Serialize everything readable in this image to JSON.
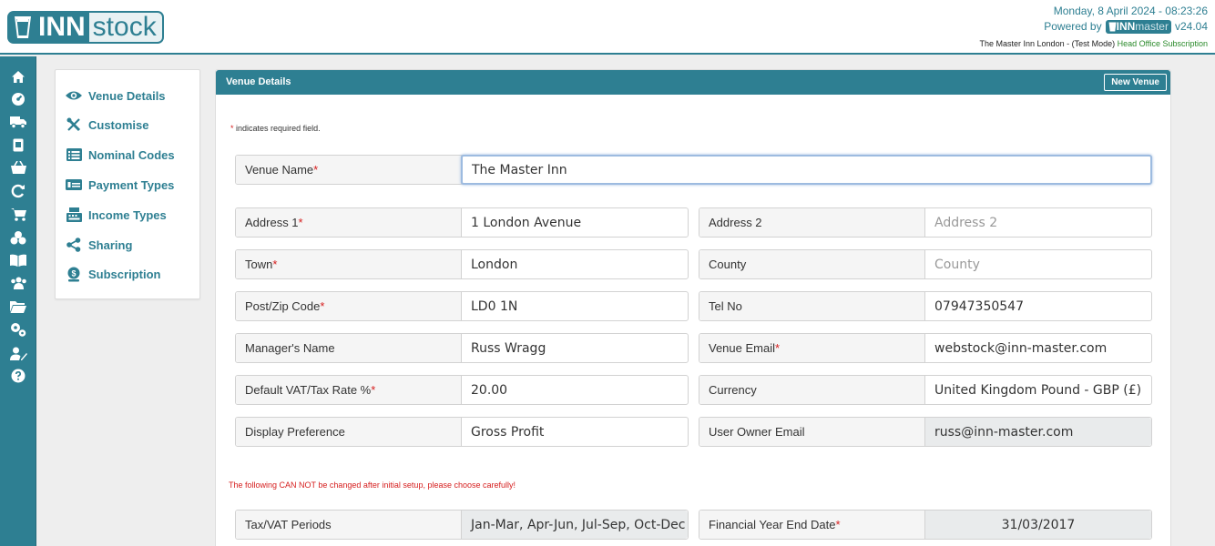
{
  "header": {
    "logo": {
      "part1": "INN",
      "part2": "stock"
    },
    "date_time": "Monday, 8 April 2024 - 08:23:26",
    "powered_by": "Powered by",
    "powered_logo": {
      "part1": "INN",
      "part2": "master"
    },
    "version": "v24.04",
    "venue_mode": "The Master Inn London - (Test Mode)",
    "subscription": "Head Office Subscription"
  },
  "rail": {
    "icons": [
      "home-icon",
      "dashboard-icon",
      "delivery-truck-icon",
      "stock-glass-icon",
      "basket-icon",
      "refresh-icon",
      "shopping-cart-icon",
      "products-icon",
      "book-icon",
      "users-icon",
      "folder-icon",
      "settings-icon",
      "user-edit-icon",
      "help-icon"
    ]
  },
  "subnav": {
    "items": [
      {
        "label": "Venue Details",
        "icon": "eye-icon"
      },
      {
        "label": "Customise",
        "icon": "tools-icon"
      },
      {
        "label": "Nominal Codes",
        "icon": "list-icon"
      },
      {
        "label": "Payment Types",
        "icon": "money-icon"
      },
      {
        "label": "Income Types",
        "icon": "cash-register-icon"
      },
      {
        "label": "Sharing",
        "icon": "share-icon"
      },
      {
        "label": "Subscription",
        "icon": "coin-icon"
      }
    ]
  },
  "panel": {
    "title": "Venue Details",
    "new_venue_label": "New Venue",
    "required_note": "indicates required field.",
    "required_star": "*",
    "warning": "The following CAN NOT be changed after initial setup, please choose carefully!"
  },
  "form": {
    "venue_name": {
      "label": "Venue Name",
      "value": "The Master Inn"
    },
    "address1": {
      "label": "Address 1",
      "value": "1 London Avenue"
    },
    "address2": {
      "label": "Address 2",
      "placeholder": "Address 2"
    },
    "town": {
      "label": "Town",
      "value": "London"
    },
    "county": {
      "label": "County",
      "placeholder": "County"
    },
    "postcode": {
      "label": "Post/Zip Code",
      "value": "LD0 1N"
    },
    "tel": {
      "label": "Tel No",
      "value": "07947350547"
    },
    "manager": {
      "label": "Manager's Name",
      "value": "Russ Wragg"
    },
    "venue_email": {
      "label": "Venue Email",
      "value": "webstock@inn-master.com"
    },
    "vat": {
      "label": "Default VAT/Tax Rate %",
      "value": "20.00"
    },
    "currency": {
      "label": "Currency",
      "value": "United Kingdom Pound - GBP (£)"
    },
    "display_pref": {
      "label": "Display Preference",
      "value": "Gross Profit"
    },
    "owner_email": {
      "label": "User Owner Email",
      "value": "russ@inn-master.com"
    },
    "tax_periods": {
      "label": "Tax/VAT Periods",
      "value": "Jan-Mar, Apr-Jun, Jul-Sep, Oct-Dec"
    },
    "fy_end": {
      "label": "Financial Year End Date",
      "value": "31/03/2017"
    }
  },
  "colors": {
    "brand": "#2e7f92",
    "required": "#d62020",
    "subscription_link": "#2a8a2a"
  }
}
